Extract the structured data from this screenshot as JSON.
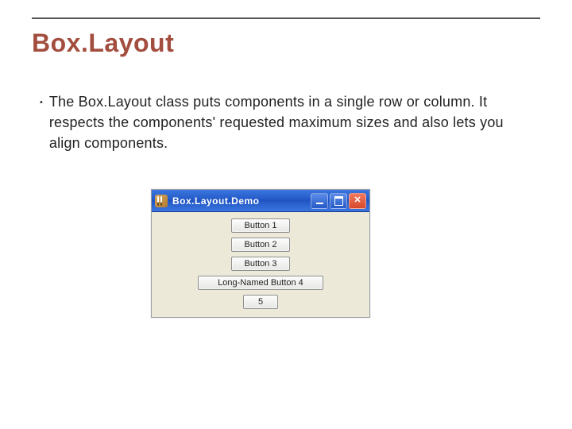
{
  "slide": {
    "title": "Box.Layout",
    "bullet": "The Box.Layout class puts components in a single row or column. It respects the components' requested maximum sizes and also lets you align components."
  },
  "demo_window": {
    "title": "Box.Layout.Demo",
    "buttons": {
      "b1": "Button 1",
      "b2": "Button 2",
      "b3": "Button 3",
      "b4": "Long-Named Button 4",
      "b5": "5"
    }
  }
}
